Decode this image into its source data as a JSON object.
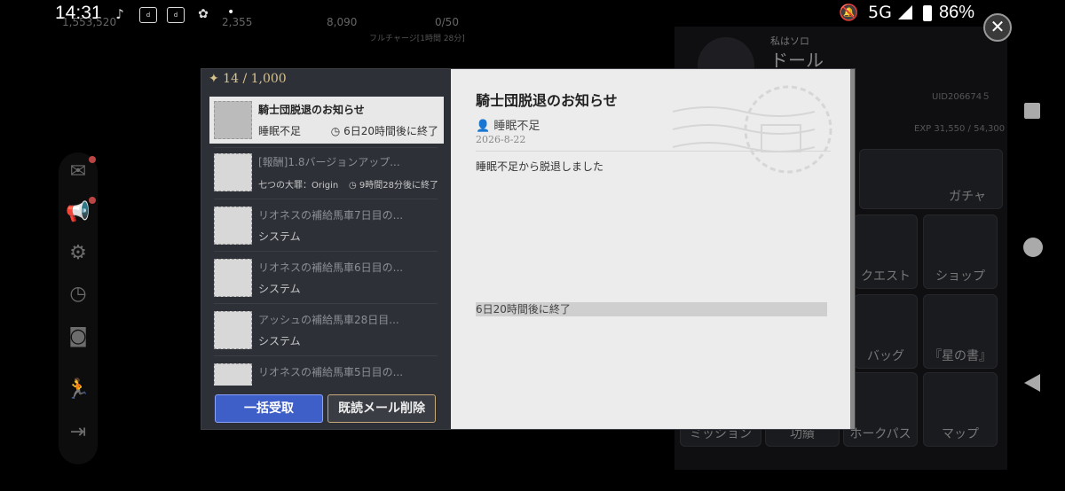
{
  "statusbar": {
    "time": "14:31",
    "notification_icons": [
      "tiktok-icon",
      "docomo-icon",
      "dcard-icon",
      "cat-icon"
    ],
    "network": "5G",
    "battery": "86%"
  },
  "background": {
    "stat1": "1,553,520",
    "stat2": "2,355",
    "stat3": "8,090",
    "stamina": "0/50",
    "full_charge": "フルチャージ[1時間 28分]",
    "profile_title": "私はソロ",
    "profile_name": "ドール",
    "uid": "UID206674５",
    "exp": "EXP 31,550 / 54,300",
    "tiles": [
      "ガチャ",
      "クエスト",
      "ショップ",
      "バッグ",
      "『星の書』",
      "ミッション",
      "功績",
      "ホークパス",
      "マップ"
    ]
  },
  "dialog": {
    "mail_count": "✦ 14 / 1,000",
    "mails": [
      {
        "title": "騎士団脱退のお知らせ",
        "sender": "睡眠不足",
        "expire": "6日20時間後に終了",
        "selected": true
      },
      {
        "title": "[報酬]1.8バージョンアップ...",
        "sender": "七つの大罪：Origin",
        "expire": "9時間28分後に終了"
      },
      {
        "title": "リオネスの補給馬車7日目の...",
        "sender": "システム",
        "expire": ""
      },
      {
        "title": "リオネスの補給馬車6日目の...",
        "sender": "システム",
        "expire": ""
      },
      {
        "title": "アッシュの補給馬車28日目...",
        "sender": "システム",
        "expire": ""
      },
      {
        "title": "リオネスの補給馬車5日目の...",
        "sender": "",
        "expire": ""
      }
    ],
    "claim_all_label": "一括受取",
    "delete_read_label": "既読メール削除",
    "detail": {
      "title": "騎士団脱退のお知らせ",
      "sender": "睡眠不足",
      "date": "2026-8-22",
      "body": "睡眠不足から脱退しました",
      "expire": "6日20時間後に終了"
    }
  }
}
